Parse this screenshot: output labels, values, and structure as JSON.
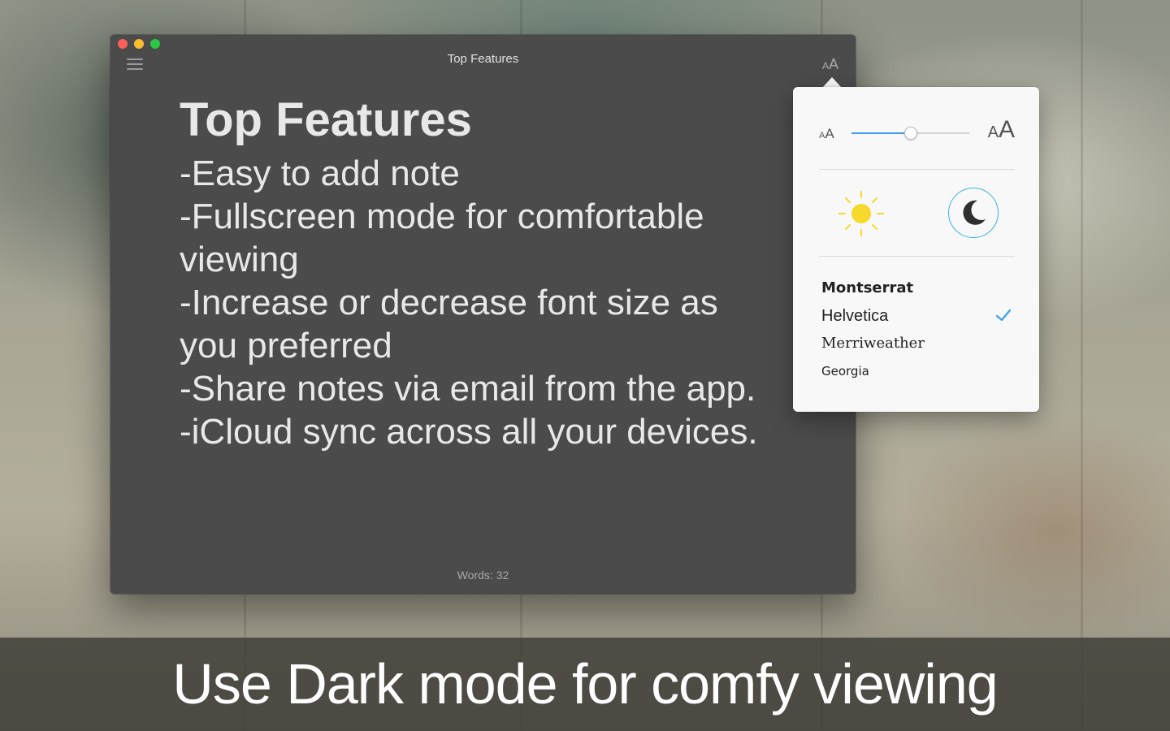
{
  "window": {
    "title": "Top Features",
    "menu_icon": "hamburger-menu-icon",
    "font_toggle_small": "A",
    "font_toggle_large": "A"
  },
  "note": {
    "heading": "Top Features",
    "lines": [
      "-Easy to add note",
      "-Fullscreen mode for comfortable viewing",
      "-Increase or decrease font size as you preferred",
      "-Share notes via email from the app.",
      "-iCloud sync across all your devices."
    ]
  },
  "footer": {
    "word_count": "Words: 32"
  },
  "popover": {
    "font_size": {
      "small_label_a": "A",
      "small_label_b": "A",
      "large_label_a": "A",
      "large_label_b": "A",
      "slider_fraction": 0.5
    },
    "themes": {
      "light_icon": "sun-icon",
      "dark_icon": "moon-icon",
      "selected": "dark",
      "accent": "#38b2e0"
    },
    "fonts": [
      {
        "label": "Montserrat",
        "selected": false
      },
      {
        "label": "Helvetica",
        "selected": true
      },
      {
        "label": "Merriweather",
        "selected": false
      },
      {
        "label": "Georgia",
        "selected": false
      }
    ],
    "check_color": "#3a9ff0"
  },
  "caption": {
    "text": "Use Dark mode for comfy viewing"
  },
  "colors": {
    "window_bg": "#4b4b4b",
    "slider_fill": "#3a9ff0",
    "sun": "#f6d92a"
  }
}
